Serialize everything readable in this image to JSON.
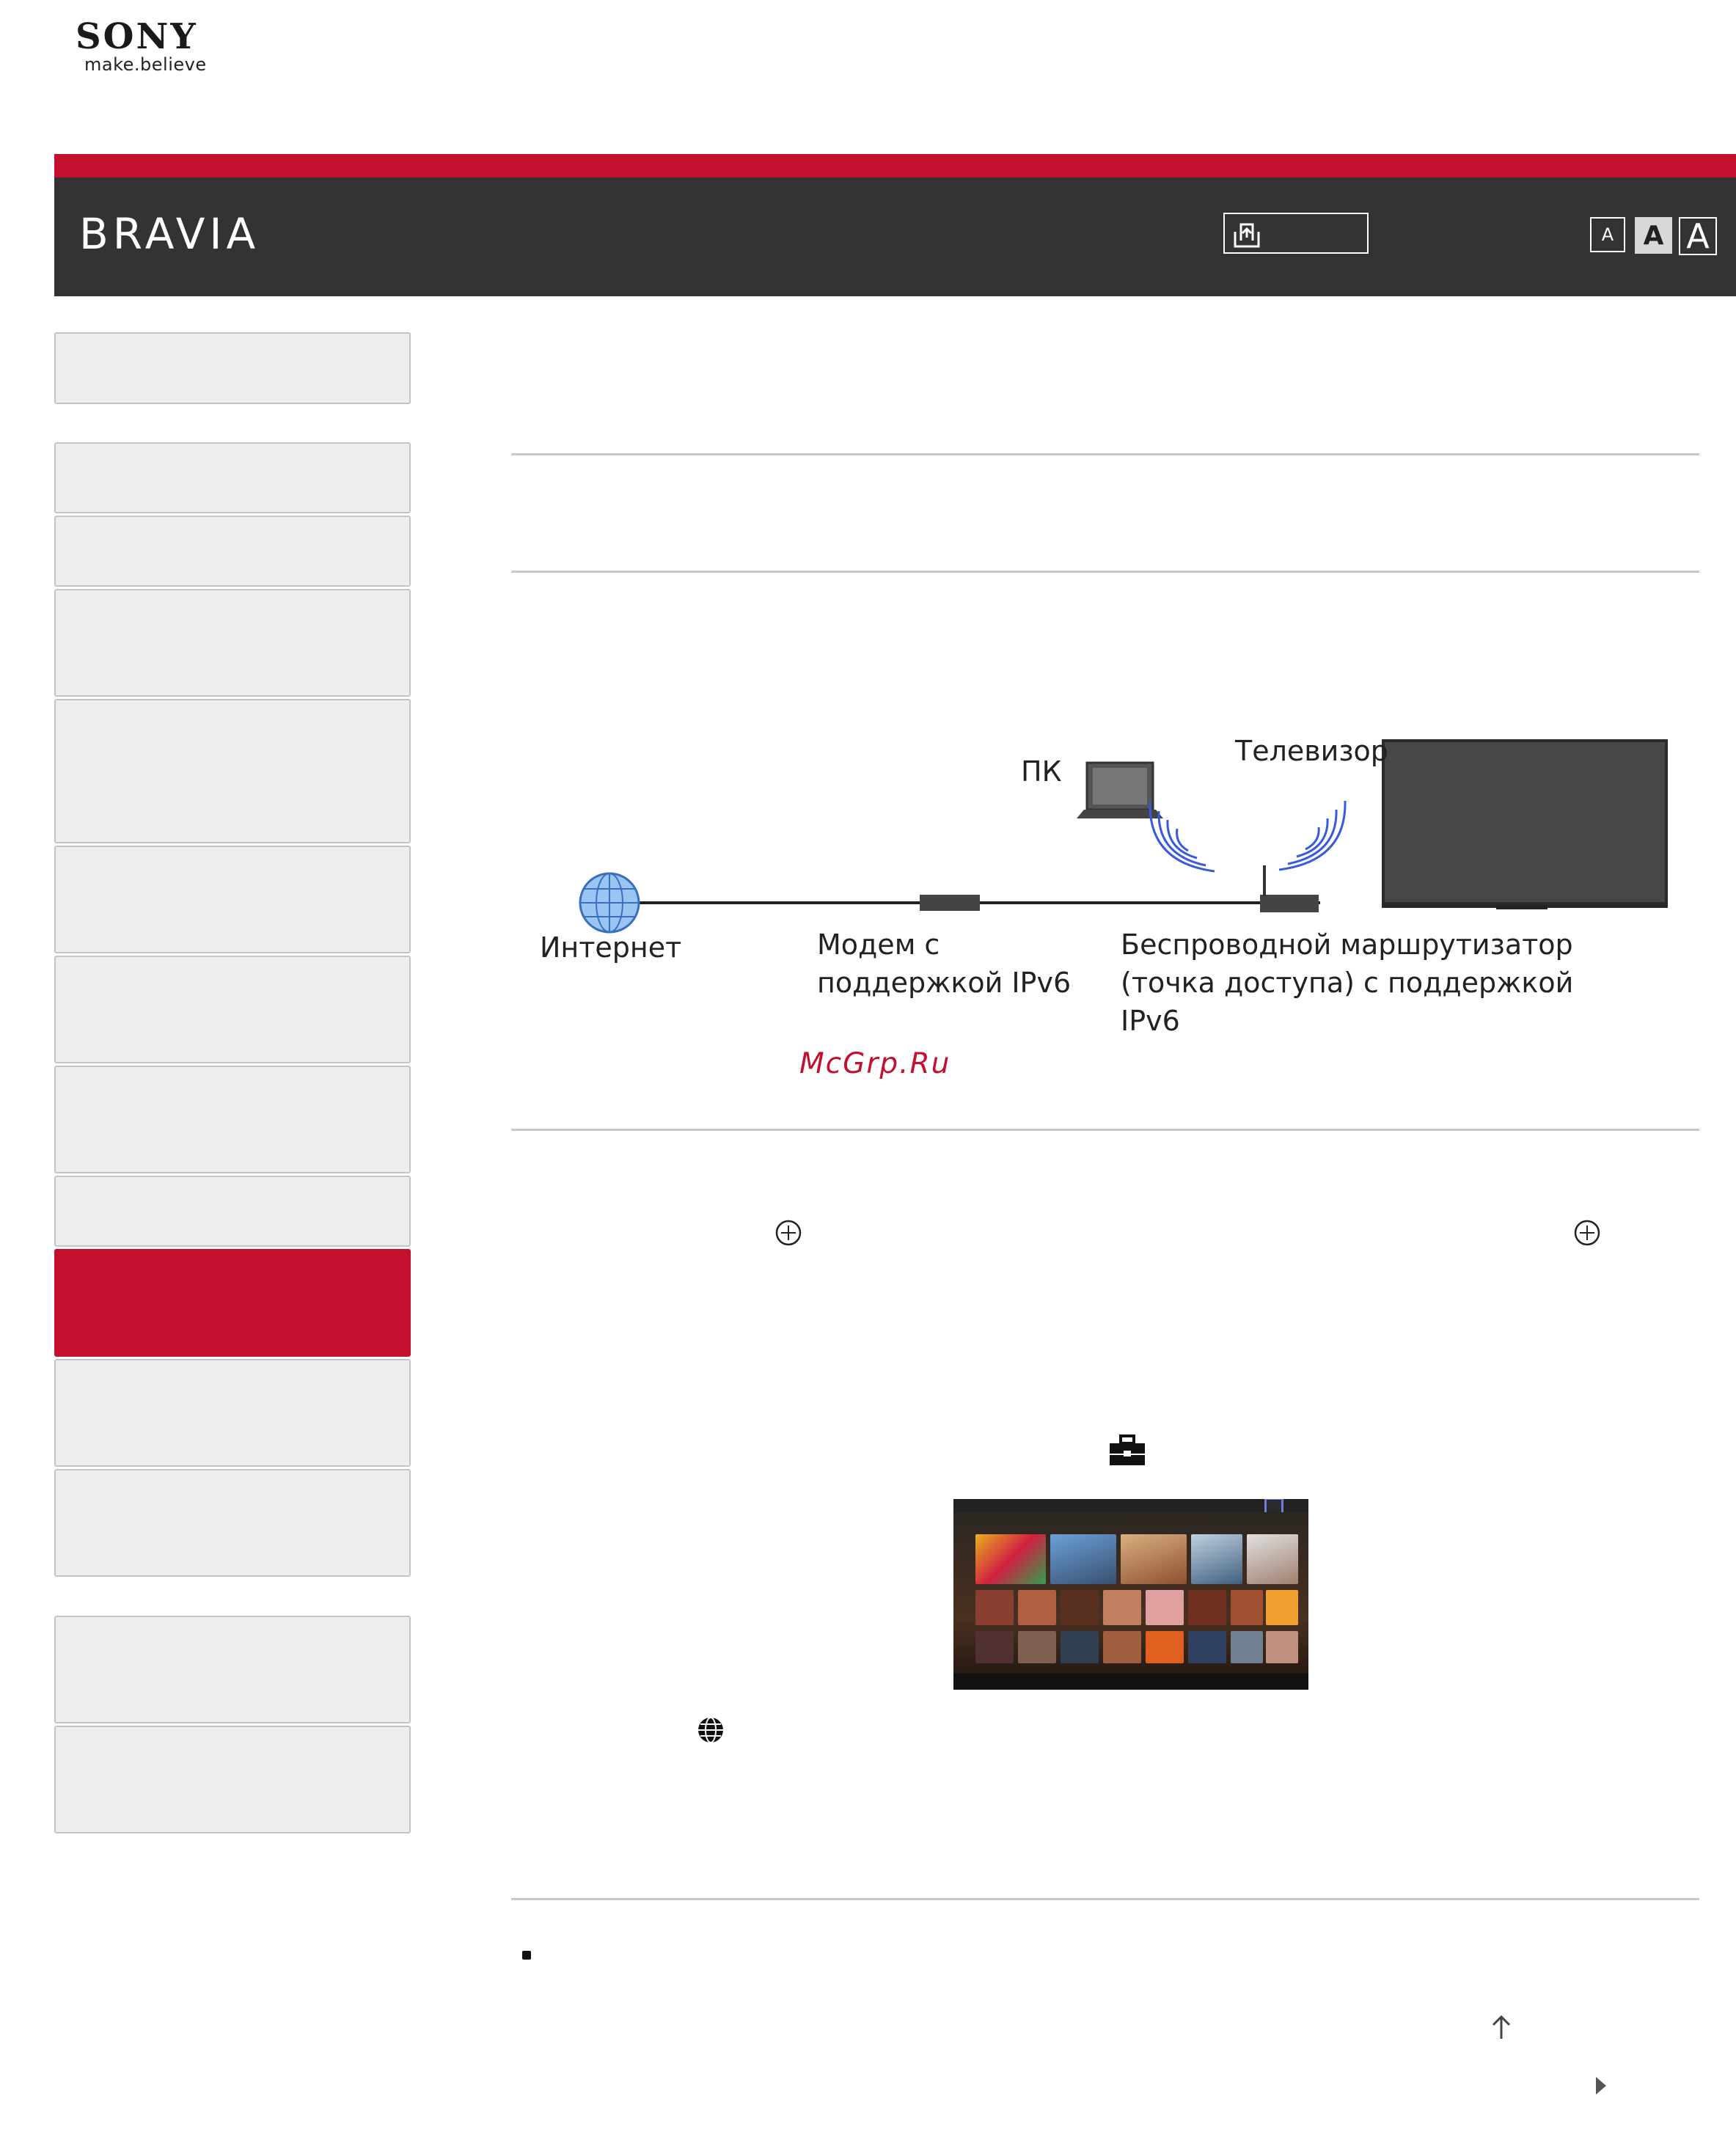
{
  "brand": {
    "logo": "SONY",
    "tagline": "make.believe"
  },
  "header": {
    "product": "BRAVIA",
    "font_sizes": [
      "A",
      "A",
      "A"
    ],
    "print_icon": "print-icon"
  },
  "diagram": {
    "labels": {
      "internet": "Интернет",
      "modem_line1": "Модем с",
      "modem_line2": "поддержкой IPv6",
      "pc": "ПК",
      "tv": "Телевизор",
      "router_line1": "Беспроводной маршрутизатор",
      "router_line2": "(точка доступа) с поддержкой",
      "router_line3": "IPv6"
    },
    "colors": {
      "line": "#222222",
      "tv": "#444444",
      "wifi": "#3a5bd8",
      "globe": "#8ab8ee"
    }
  },
  "watermark": "McGrp.Ru",
  "icons": [
    "enter-icon",
    "toolbox-icon",
    "globe-icon",
    "scroll-up-icon",
    "next-arrow-icon"
  ],
  "accent": "#c3102f"
}
